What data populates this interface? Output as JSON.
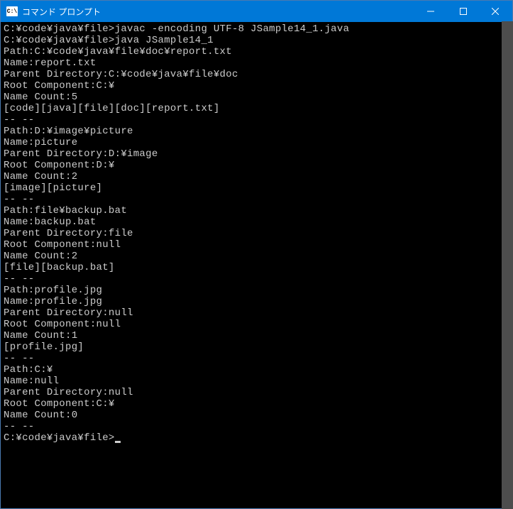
{
  "window": {
    "title": "コマンド プロンプト",
    "icon_label": "C:\\"
  },
  "terminal": {
    "lines": [
      "",
      "C:¥code¥java¥file>javac -encoding UTF-8 JSample14_1.java",
      "",
      "C:¥code¥java¥file>java JSample14_1",
      "Path:C:¥code¥java¥file¥doc¥report.txt",
      "Name:report.txt",
      "Parent Directory:C:¥code¥java¥file¥doc",
      "Root Component:C:¥",
      "Name Count:5",
      "[code][java][file][doc][report.txt]",
      "-- --",
      "Path:D:¥image¥picture",
      "Name:picture",
      "Parent Directory:D:¥image",
      "Root Component:D:¥",
      "Name Count:2",
      "[image][picture]",
      "-- --",
      "Path:file¥backup.bat",
      "Name:backup.bat",
      "Parent Directory:file",
      "Root Component:null",
      "Name Count:2",
      "[file][backup.bat]",
      "-- --",
      "Path:profile.jpg",
      "Name:profile.jpg",
      "Parent Directory:null",
      "Root Component:null",
      "Name Count:1",
      "[profile.jpg]",
      "-- --",
      "Path:C:¥",
      "Name:null",
      "Parent Directory:null",
      "Root Component:C:¥",
      "Name Count:0",
      "",
      "-- --",
      "",
      "C:¥code¥java¥file>"
    ]
  }
}
